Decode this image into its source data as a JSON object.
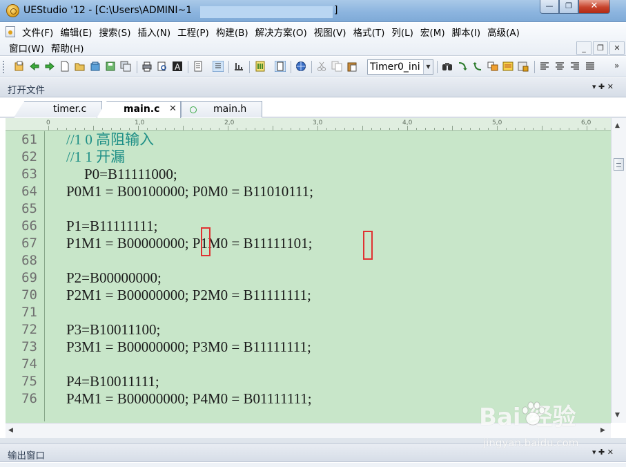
{
  "window": {
    "title": "UEStudio '12 - [C:\\Users\\ADMINI~1",
    "title_suffix": "]",
    "btn_min": "—",
    "btn_max": "❐",
    "btn_close": "✕"
  },
  "menu": {
    "row1": [
      "文件(F)",
      "编辑(E)",
      "搜索(S)",
      "插入(N)",
      "工程(P)",
      "构建(B)",
      "解决方案(O)",
      "视图(V)",
      "格式(T)",
      "列(L)",
      "宏(M)",
      "脚本(I)",
      "高级(A)"
    ],
    "row2": [
      "窗口(W)",
      "帮助(H)"
    ],
    "mdi_min": "_",
    "mdi_restore": "❐",
    "mdi_close": "✕"
  },
  "toolbar": {
    "function_combo": "Timer0_ini",
    "more": "»"
  },
  "open_files_panel": {
    "title": "打开文件",
    "pin": "▾ ✚ ✕"
  },
  "tabs": [
    {
      "label": "timer.c"
    },
    {
      "label": "main.c",
      "close": "✕"
    },
    {
      "label": "main.h"
    }
  ],
  "ruler": [
    "0",
    "1,0",
    "2,0",
    "3,0",
    "4,0",
    "5,0",
    "6,0"
  ],
  "code_lines": [
    {
      "num": "61",
      "text": "//1 0 高阻输入",
      "kind": "comment"
    },
    {
      "num": "62",
      "text": "//1 1 开漏",
      "kind": "comment"
    },
    {
      "num": "63",
      "text": "P0=B11111000;",
      "kind": "indent"
    },
    {
      "num": "64",
      "text": "P0M1 = B00100000; P0M0 = B11010111;",
      "kind": "code"
    },
    {
      "num": "65",
      "text": "",
      "kind": "code"
    },
    {
      "num": "66",
      "text": "P1=B11111111;",
      "kind": "code"
    },
    {
      "num": "67",
      "text": "P1M1 = B00000000; P1M0 = B11111101;",
      "kind": "code"
    },
    {
      "num": "68",
      "text": "",
      "kind": "code"
    },
    {
      "num": "69",
      "text": "P2=B00000000;",
      "kind": "code"
    },
    {
      "num": "70",
      "text": "P2M1 = B00000000; P2M0 = B11111111;",
      "kind": "code"
    },
    {
      "num": "71",
      "text": "",
      "kind": "code"
    },
    {
      "num": "72",
      "text": "P3=B10011100;",
      "kind": "code"
    },
    {
      "num": "73",
      "text": "P3M1 = B00000000; P3M0 = B11111111;",
      "kind": "code"
    },
    {
      "num": "74",
      "text": "",
      "kind": "code"
    },
    {
      "num": "75",
      "text": "P4=B10011111;",
      "kind": "code"
    },
    {
      "num": "76",
      "text": "P4M1 = B00000000; P4M0 = B01111111;",
      "kind": "code"
    }
  ],
  "output_panel": {
    "title": "输出窗口",
    "pin": "▾ ✚ ✕"
  },
  "watermark": {
    "brand": "Bai   经验",
    "url": "jingyan.baidu.com"
  },
  "colors": {
    "editor_bg": "#c8e6c9",
    "comment": "#1e8f86",
    "highlight": "#e03131"
  }
}
